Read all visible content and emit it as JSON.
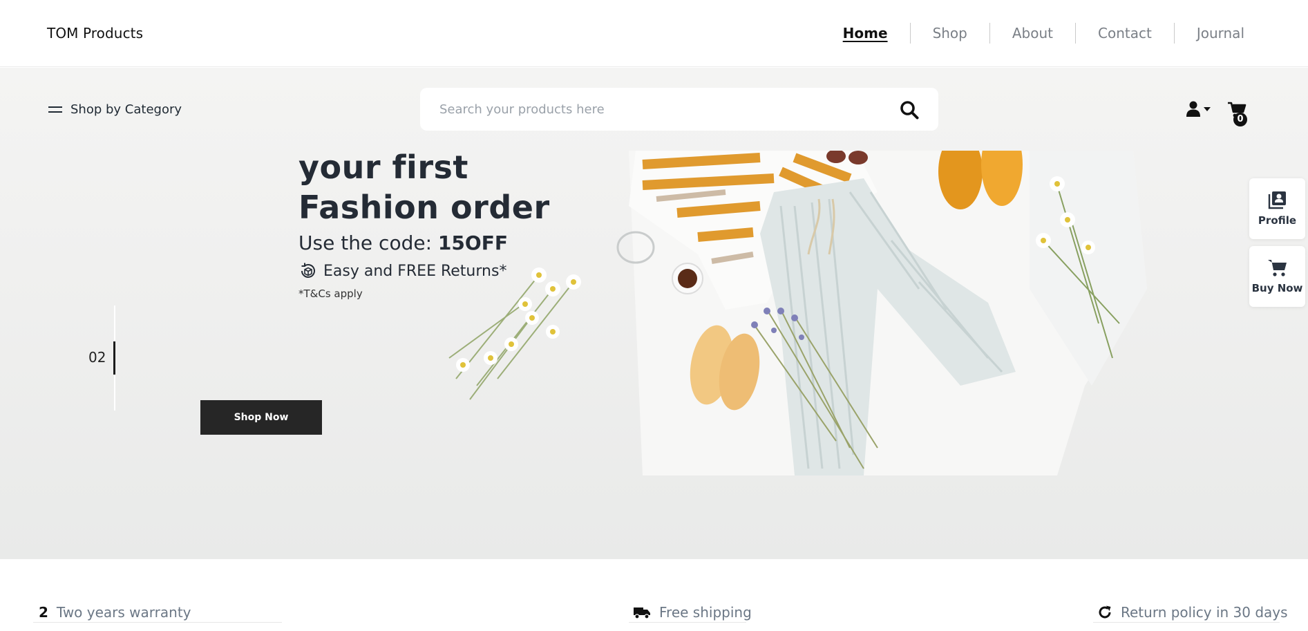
{
  "brand": "TOM Products",
  "nav": [
    {
      "label": "Home",
      "active": true
    },
    {
      "label": "Shop",
      "active": false
    },
    {
      "label": "About",
      "active": false
    },
    {
      "label": "Contact",
      "active": false
    },
    {
      "label": "Journal",
      "active": false
    }
  ],
  "toolbar": {
    "category_label": "Shop by Category",
    "search_placeholder": "Search your products here",
    "cart_count": "0"
  },
  "hero": {
    "heading_line1": "your first",
    "heading_line2": "Fashion order",
    "code_prefix": "Use the code: ",
    "code": "15OFF",
    "returns": "Easy and FREE Returns*",
    "terms": "*T&Cs apply",
    "slide_number": "02",
    "cta": "Shop Now"
  },
  "side_cards": {
    "profile": "Profile",
    "buy_now": "Buy Now"
  },
  "features": {
    "warranty_mark": "2",
    "warranty": "Two years warranty",
    "shipping": "Free shipping",
    "returns": "Return policy in 30 days"
  },
  "colors": {
    "accent_dark": "#262626",
    "heading": "#242b35",
    "muted_text": "#6b7785",
    "hero_bg": "#f0f0ef"
  }
}
